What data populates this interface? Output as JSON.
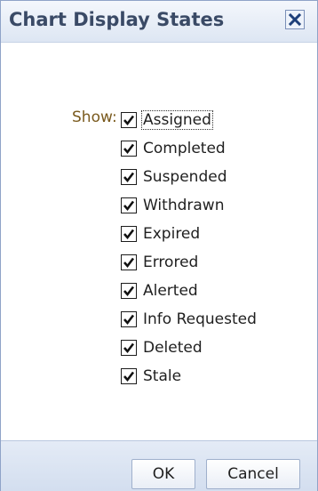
{
  "dialog": {
    "title": "Chart Display States",
    "close_icon": "close-icon"
  },
  "form": {
    "show_label": "Show:",
    "options": [
      {
        "label": "Assigned",
        "checked": true
      },
      {
        "label": "Completed",
        "checked": true
      },
      {
        "label": "Suspended",
        "checked": true
      },
      {
        "label": "Withdrawn",
        "checked": true
      },
      {
        "label": "Expired",
        "checked": true
      },
      {
        "label": "Errored",
        "checked": true
      },
      {
        "label": "Alerted",
        "checked": true
      },
      {
        "label": "Info Requested",
        "checked": true
      },
      {
        "label": "Deleted",
        "checked": true
      },
      {
        "label": "Stale",
        "checked": true
      }
    ]
  },
  "footer": {
    "ok_label": "OK",
    "cancel_label": "Cancel"
  },
  "colors": {
    "title_text": "#3a4a66",
    "show_label": "#7a5a1e",
    "accent": "#8fa3c8"
  }
}
